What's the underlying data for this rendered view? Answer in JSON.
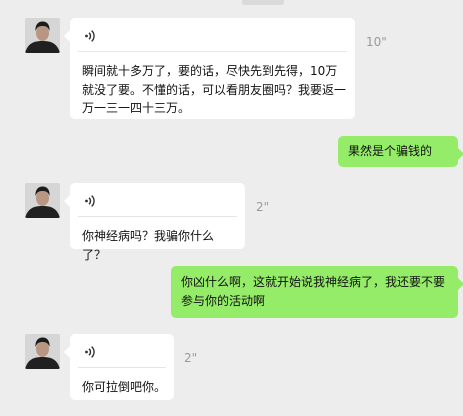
{
  "chat": {
    "messages": [
      {
        "sender": "other",
        "type": "voice-with-transcript",
        "duration": "10\"",
        "transcript": "瞬间就十多万了，要的话，尽快先到先得，10万就没了要。不懂的话，可以看朋友圈吗？我要返一万一三一四十三万。"
      },
      {
        "sender": "self",
        "type": "text",
        "text": "果然是个骗钱的"
      },
      {
        "sender": "other",
        "type": "voice-with-transcript",
        "duration": "2\"",
        "transcript": "你神经病吗？我骗你什么了？"
      },
      {
        "sender": "self",
        "type": "text",
        "text": "你凶什么啊，这就开始说我神经病了，我还要不要参与你的活动啊"
      },
      {
        "sender": "other",
        "type": "voice-with-transcript",
        "duration": "2\"",
        "transcript": "你可拉倒吧你。"
      }
    ]
  },
  "colors": {
    "background": "#ededed",
    "incoming_bubble": "#ffffff",
    "outgoing_bubble": "#95ec69",
    "duration_text": "#9a9a9a"
  },
  "icons": {
    "avatar": "user-avatar",
    "voice": "voice-wave-icon"
  }
}
